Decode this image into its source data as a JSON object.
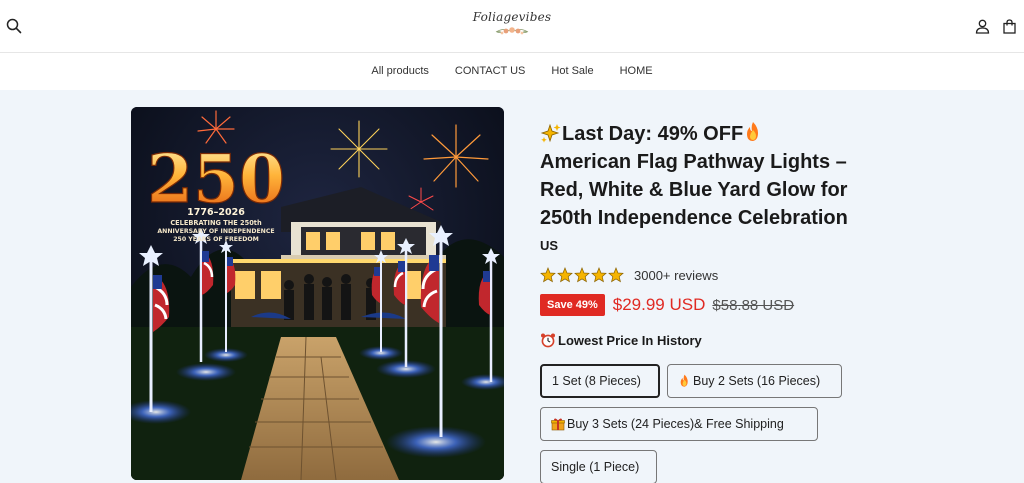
{
  "header": {
    "logo_text": "Foliagevibes",
    "search_icon": "search-icon",
    "account_icon": "user-icon",
    "cart_icon": "bag-icon"
  },
  "nav": {
    "items": [
      "All products",
      "CONTACT US",
      "Hot Sale",
      "HOME"
    ]
  },
  "product": {
    "image_overlay": {
      "big_number": "250",
      "years": "1776–2026",
      "line1": "CELEBRATING THE 250th",
      "line2": "ANNIVERSARY OF INDEPENDENCE",
      "line3": "250 YEARS OF FREEDOM"
    },
    "title_line1": "Last Day: 49% OFF",
    "title_line2": "American Flag Pathway Lights –",
    "title_line3": "Red, White & Blue Yard Glow for",
    "title_line4": "250th Independence Celebration",
    "vendor": "US",
    "rating_stars": 5,
    "reviews": "3000+ reviews",
    "save_badge": "Save 49%",
    "price": "$29.99 USD",
    "compare_price": "$58.88 USD",
    "lowest_price_label": "Lowest Price In History",
    "variants": [
      {
        "label": "1 Set (8 Pieces)",
        "selected": true
      },
      {
        "label": "Buy 2 Sets (16 Pieces)",
        "selected": false
      },
      {
        "label": "Buy 3 Sets (24 Pieces)& Free Shipping",
        "selected": false
      },
      {
        "label": "Single (1 Piece)",
        "selected": false
      }
    ]
  },
  "colors": {
    "accent_red": "#e02a23",
    "main_bg": "#f0f5fa",
    "star_gold": "#f5b400"
  }
}
